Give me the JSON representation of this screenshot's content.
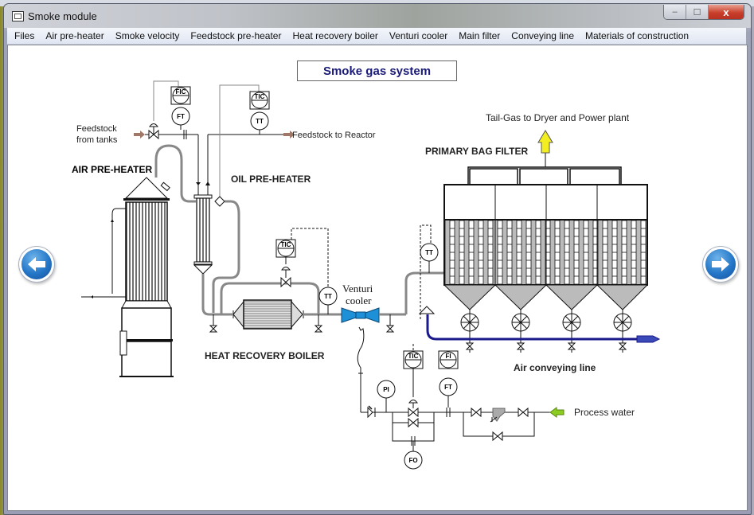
{
  "window": {
    "title": "Smoke module",
    "controls": {
      "minimize": "–",
      "maximize": "☐",
      "close": "x"
    }
  },
  "menu": [
    "Files",
    "Air pre-heater",
    "Smoke velocity",
    "Feedstock pre-heater",
    "Heat recovery boiler",
    "Venturi cooler",
    "Main filter",
    "Conveying line",
    "Materials of construction"
  ],
  "diagram": {
    "title": "Smoke gas system",
    "labels": {
      "feedstock_in_1": "Feedstock",
      "feedstock_in_2": "from tanks",
      "feedstock_out": "Feedstock to Reactor",
      "air_preheater": "AIR PRE-HEATER",
      "oil_preheater": "OIL PRE-HEATER",
      "heat_recovery_boiler": "HEAT RECOVERY BOILER",
      "venturi_1": "Venturi",
      "venturi_2": "cooler",
      "tail_gas": "Tail-Gas to Dryer and Power plant",
      "bag_filter": "PRIMARY BAG FILTER",
      "air_conveying": "Air conveying line",
      "process_water": "Process water"
    },
    "instruments": {
      "fic": "FIC",
      "ft1": "FT",
      "tic1": "TIC",
      "tt1": "TT",
      "tic2": "TIC",
      "tt2": "TT",
      "tt3": "TT",
      "tic3": "TIC",
      "fi": "FI",
      "ft2": "FT",
      "pi": "PI",
      "fo": "FO"
    },
    "colors": {
      "venturi": "#1e90d8",
      "tail_gas_arrow": "#f2ee20",
      "air_line": "#1a1a8c",
      "process_water_arrow": "#8ccc20",
      "feed_arrow": "#a07868",
      "pipe": "#888888"
    }
  },
  "navigation": {
    "prev": "previous-page",
    "next": "next-page"
  }
}
